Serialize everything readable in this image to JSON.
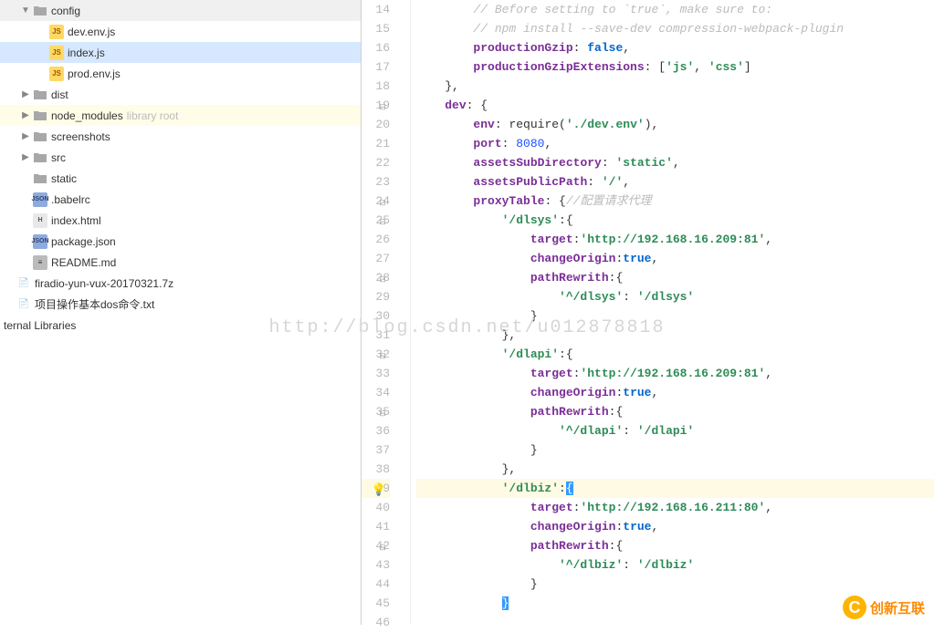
{
  "tree": {
    "config": {
      "label": "config",
      "children": {
        "dev": "dev.env.js",
        "index": "index.js",
        "prod": "prod.env.js"
      }
    },
    "dist": "dist",
    "node_modules": {
      "label": "node_modules",
      "suffix": "library root"
    },
    "screenshots": "screenshots",
    "src": "src",
    "static": "static",
    "babelrc": ".babelrc",
    "indexhtml": "index.html",
    "packagejson": "package.json",
    "readme": "README.md",
    "firadio": "firadio-yun-vux-20170321.7z",
    "dostxt": "项目操作基本dos命令.txt",
    "extlib": "ternal Libraries"
  },
  "watermark": "http://blog.csdn.net/u012878818",
  "logo": "创新互联",
  "code": {
    "lines": [
      14,
      15,
      16,
      17,
      18,
      19,
      20,
      21,
      22,
      23,
      24,
      25,
      26,
      27,
      28,
      29,
      30,
      31,
      32,
      33,
      34,
      35,
      36,
      37,
      38,
      39,
      40,
      41,
      42,
      43,
      44,
      45,
      46
    ],
    "c14": "// Before setting to `true`, make sure to:",
    "c15": "// npm install --save-dev compression-webpack-plugin",
    "k16": "productionGzip",
    "v16": "false",
    "k17": "productionGzipExtensions",
    "v17a": "'js'",
    "v17b": "'css'",
    "k19": "dev",
    "k20": "env",
    "f20": "require",
    "s20": "'./dev.env'",
    "k21": "port",
    "v21": "8080",
    "k22": "assetsSubDirectory",
    "v22": "'static'",
    "k23": "assetsPublicPath",
    "v23": "'/'",
    "k24": "proxyTable",
    "c24": "//配置请求代理",
    "s25": "'/dlsys'",
    "k26": "target",
    "v26": "'http://192.168.16.209:81'",
    "k27": "changeOrigin",
    "v27": "true",
    "k28": "pathRewrith",
    "s29a": "'^/dlsys'",
    "s29b": "'/dlsys'",
    "s32": "'/dlapi'",
    "k33": "target",
    "v33": "'http://192.168.16.209:81'",
    "k34": "changeOrigin",
    "v34": "true",
    "k35": "pathRewrith",
    "s36a": "'^/dlapi'",
    "s36b": "'/dlapi'",
    "s39": "'/dlbiz'",
    "k40": "target",
    "v40": "'http://192.168.16.211:80'",
    "k41": "changeOrigin",
    "v41": "true",
    "k42": "pathRewrith",
    "s43a": "'^/dlbiz'",
    "s43b": "'/dlbiz'"
  }
}
